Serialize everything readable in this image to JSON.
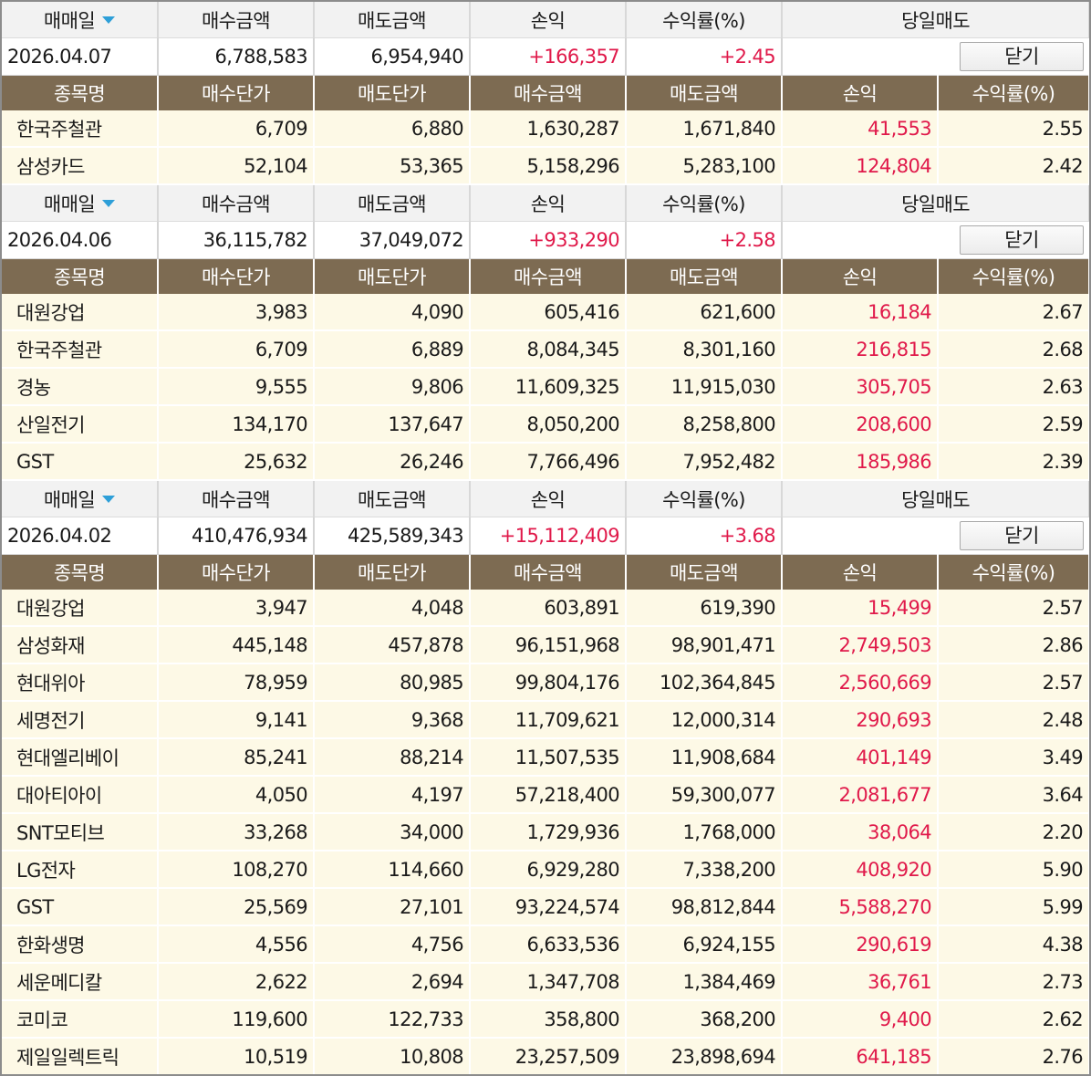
{
  "summary_headers": [
    "매매일",
    "매수금액",
    "매도금액",
    "손익",
    "수익률(%)",
    "당일매도"
  ],
  "detail_headers": [
    "종목명",
    "매수단가",
    "매도단가",
    "매수금액",
    "매도금액",
    "손익",
    "수익률(%)"
  ],
  "close_label": "닫기",
  "colors": {
    "header_brown": "#7d6b52",
    "row_cream": "#fdf9e6",
    "profit_red": "#e0194a",
    "sort_arrow": "#2e9fd8"
  },
  "groups": [
    {
      "date": "2026.04.07",
      "buy_total": "6,788,583",
      "sell_total": "6,954,940",
      "pnl": "+166,357",
      "rate": "+2.45",
      "rows": [
        {
          "name": "한국주철관",
          "buy_price": "6,709",
          "sell_price": "6,880",
          "buy_amt": "1,630,287",
          "sell_amt": "1,671,840",
          "pnl": "41,553",
          "rate": "2.55"
        },
        {
          "name": "삼성카드",
          "buy_price": "52,104",
          "sell_price": "53,365",
          "buy_amt": "5,158,296",
          "sell_amt": "5,283,100",
          "pnl": "124,804",
          "rate": "2.42"
        }
      ]
    },
    {
      "date": "2026.04.06",
      "buy_total": "36,115,782",
      "sell_total": "37,049,072",
      "pnl": "+933,290",
      "rate": "+2.58",
      "rows": [
        {
          "name": "대원강업",
          "buy_price": "3,983",
          "sell_price": "4,090",
          "buy_amt": "605,416",
          "sell_amt": "621,600",
          "pnl": "16,184",
          "rate": "2.67"
        },
        {
          "name": "한국주철관",
          "buy_price": "6,709",
          "sell_price": "6,889",
          "buy_amt": "8,084,345",
          "sell_amt": "8,301,160",
          "pnl": "216,815",
          "rate": "2.68"
        },
        {
          "name": "경농",
          "buy_price": "9,555",
          "sell_price": "9,806",
          "buy_amt": "11,609,325",
          "sell_amt": "11,915,030",
          "pnl": "305,705",
          "rate": "2.63"
        },
        {
          "name": "산일전기",
          "buy_price": "134,170",
          "sell_price": "137,647",
          "buy_amt": "8,050,200",
          "sell_amt": "8,258,800",
          "pnl": "208,600",
          "rate": "2.59"
        },
        {
          "name": "GST",
          "buy_price": "25,632",
          "sell_price": "26,246",
          "buy_amt": "7,766,496",
          "sell_amt": "7,952,482",
          "pnl": "185,986",
          "rate": "2.39"
        }
      ]
    },
    {
      "date": "2026.04.02",
      "buy_total": "410,476,934",
      "sell_total": "425,589,343",
      "pnl": "+15,112,409",
      "rate": "+3.68",
      "rows": [
        {
          "name": "대원강업",
          "buy_price": "3,947",
          "sell_price": "4,048",
          "buy_amt": "603,891",
          "sell_amt": "619,390",
          "pnl": "15,499",
          "rate": "2.57"
        },
        {
          "name": "삼성화재",
          "buy_price": "445,148",
          "sell_price": "457,878",
          "buy_amt": "96,151,968",
          "sell_amt": "98,901,471",
          "pnl": "2,749,503",
          "rate": "2.86"
        },
        {
          "name": "현대위아",
          "buy_price": "78,959",
          "sell_price": "80,985",
          "buy_amt": "99,804,176",
          "sell_amt": "102,364,845",
          "pnl": "2,560,669",
          "rate": "2.57"
        },
        {
          "name": "세명전기",
          "buy_price": "9,141",
          "sell_price": "9,368",
          "buy_amt": "11,709,621",
          "sell_amt": "12,000,314",
          "pnl": "290,693",
          "rate": "2.48"
        },
        {
          "name": "현대엘리베이",
          "buy_price": "85,241",
          "sell_price": "88,214",
          "buy_amt": "11,507,535",
          "sell_amt": "11,908,684",
          "pnl": "401,149",
          "rate": "3.49"
        },
        {
          "name": "대아티아이",
          "buy_price": "4,050",
          "sell_price": "4,197",
          "buy_amt": "57,218,400",
          "sell_amt": "59,300,077",
          "pnl": "2,081,677",
          "rate": "3.64"
        },
        {
          "name": "SNT모티브",
          "buy_price": "33,268",
          "sell_price": "34,000",
          "buy_amt": "1,729,936",
          "sell_amt": "1,768,000",
          "pnl": "38,064",
          "rate": "2.20"
        },
        {
          "name": "LG전자",
          "buy_price": "108,270",
          "sell_price": "114,660",
          "buy_amt": "6,929,280",
          "sell_amt": "7,338,200",
          "pnl": "408,920",
          "rate": "5.90"
        },
        {
          "name": "GST",
          "buy_price": "25,569",
          "sell_price": "27,101",
          "buy_amt": "93,224,574",
          "sell_amt": "98,812,844",
          "pnl": "5,588,270",
          "rate": "5.99"
        },
        {
          "name": "한화생명",
          "buy_price": "4,556",
          "sell_price": "4,756",
          "buy_amt": "6,633,536",
          "sell_amt": "6,924,155",
          "pnl": "290,619",
          "rate": "4.38"
        },
        {
          "name": "세운메디칼",
          "buy_price": "2,622",
          "sell_price": "2,694",
          "buy_amt": "1,347,708",
          "sell_amt": "1,384,469",
          "pnl": "36,761",
          "rate": "2.73"
        },
        {
          "name": "코미코",
          "buy_price": "119,600",
          "sell_price": "122,733",
          "buy_amt": "358,800",
          "sell_amt": "368,200",
          "pnl": "9,400",
          "rate": "2.62"
        },
        {
          "name": "제일일렉트릭",
          "buy_price": "10,519",
          "sell_price": "10,808",
          "buy_amt": "23,257,509",
          "sell_amt": "23,898,694",
          "pnl": "641,185",
          "rate": "2.76"
        }
      ]
    }
  ]
}
